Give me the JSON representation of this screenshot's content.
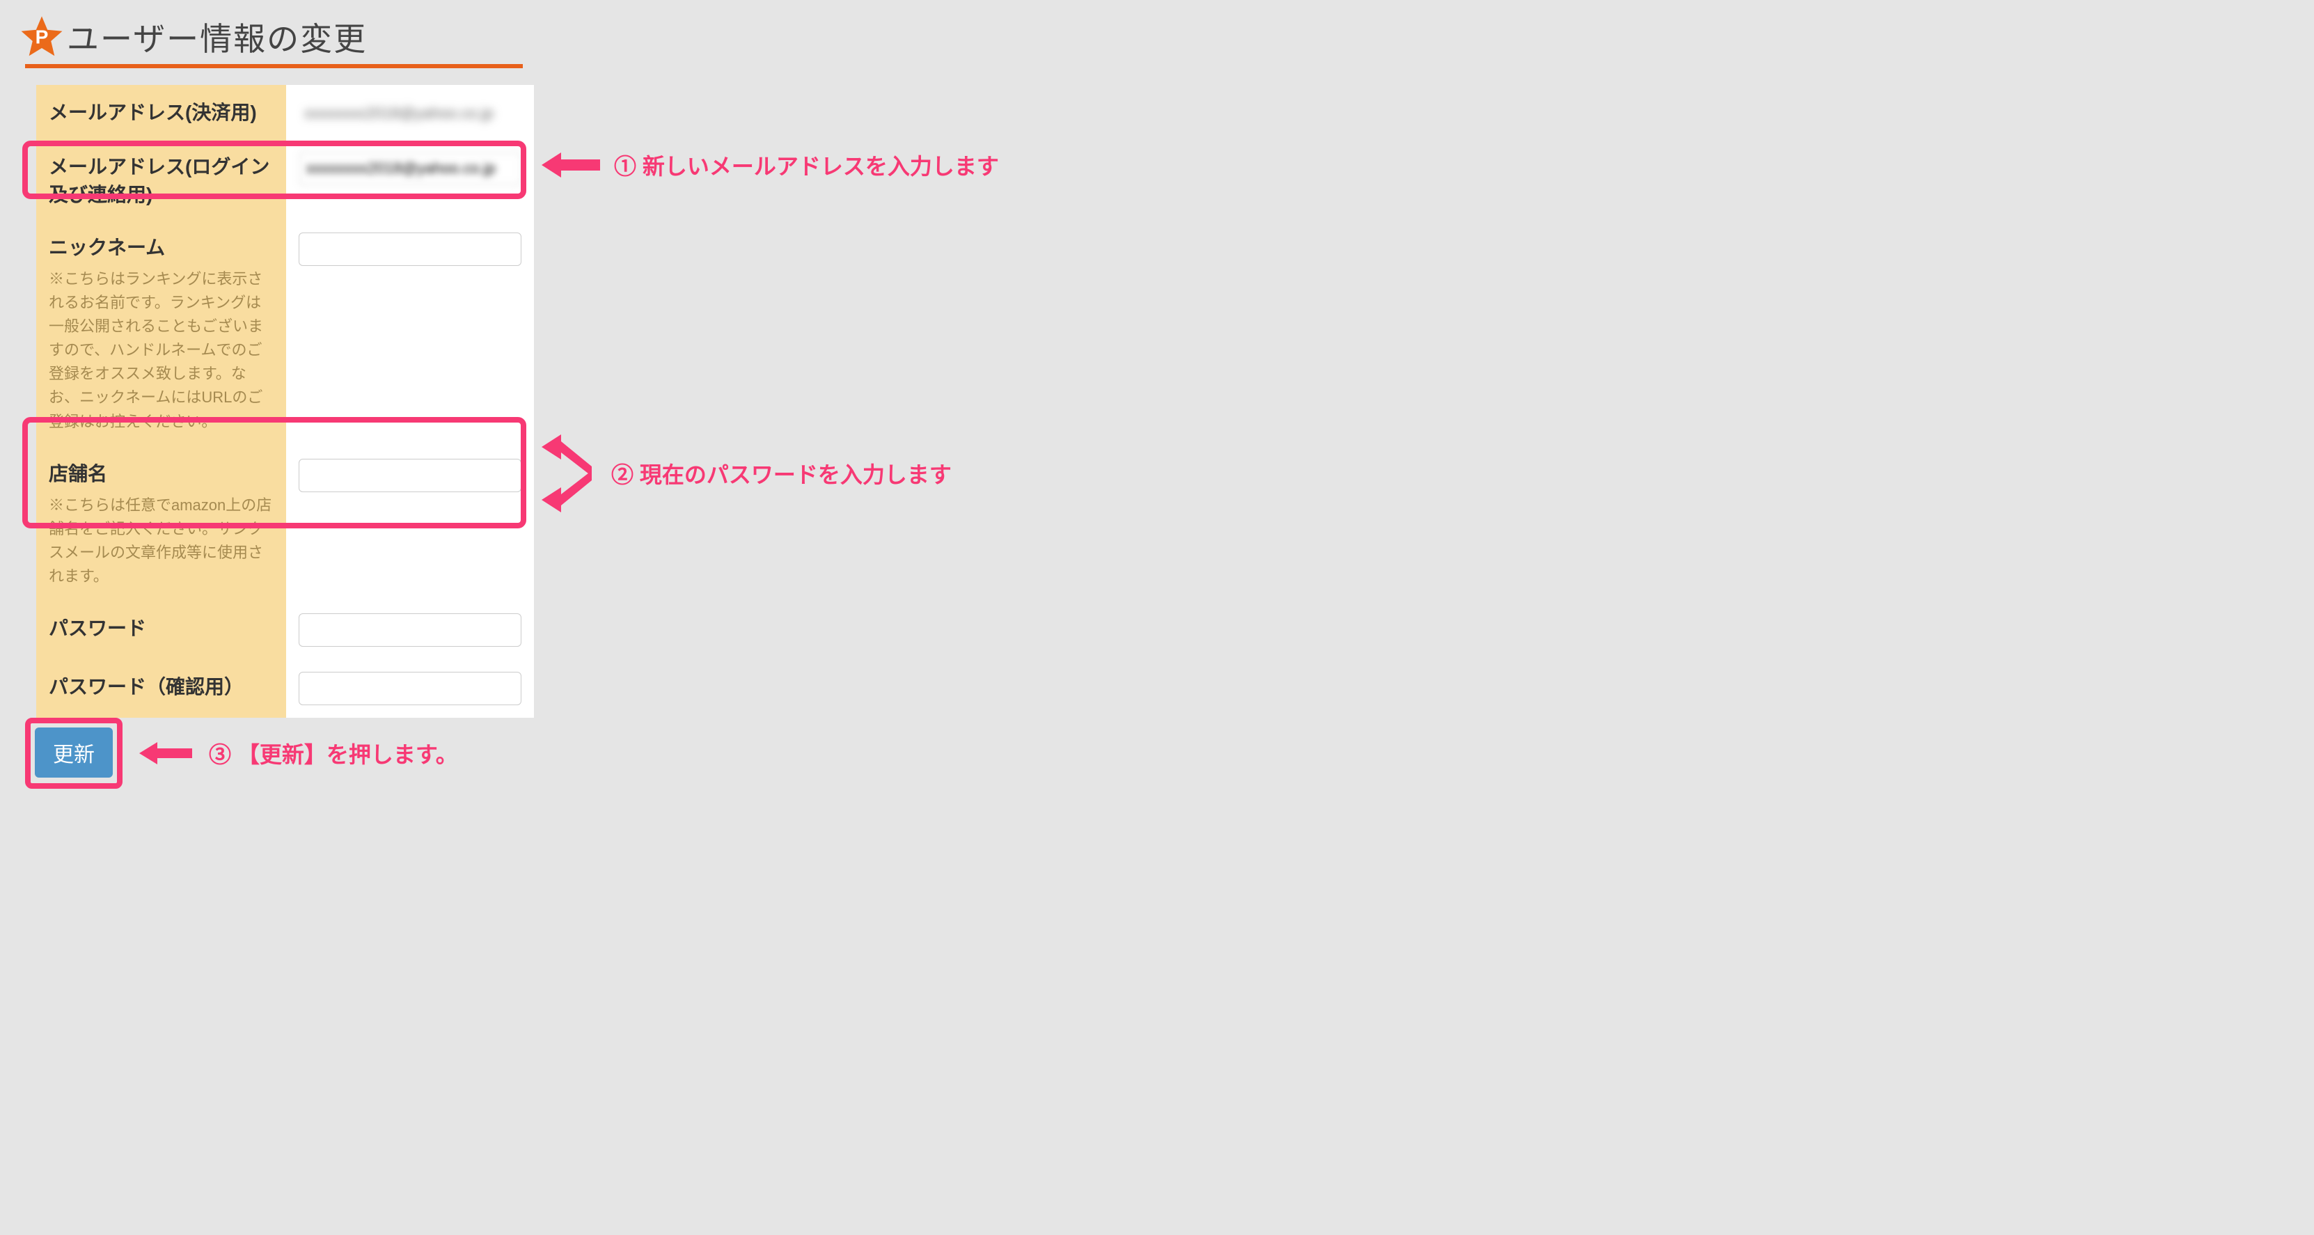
{
  "header": {
    "title": "ユーザー情報の変更",
    "icon": "P"
  },
  "rows": {
    "email_payment": {
      "label": "メールアドレス(決済用)",
      "value_placeholder": "xxxxxxxx2018@yahoo.co.jp"
    },
    "email_login": {
      "label": "メールアドレス(ログイン及び連絡用)",
      "value_placeholder": "xxxxxxxx2018@yahoo.co.jp"
    },
    "nickname": {
      "label": "ニックネーム",
      "note": "※こちらはランキングに表示されるお名前です。ランキングは一般公開されることもございますので、ハンドルネームでのご登録をオススメ致します。なお、ニックネームにはURLのご登録はお控えください。"
    },
    "shop": {
      "label": "店舗名",
      "note": "※こちらは任意でamazon上の店舗名をご記入ください。サンクスメールの文章作成等に使用されます。"
    },
    "password": {
      "label": "パスワード"
    },
    "password_confirm": {
      "label": "パスワード（確認用）"
    }
  },
  "button": {
    "update": "更新"
  },
  "annotations": {
    "a1": "① 新しいメールアドレスを入力します",
    "a2": "② 現在のパスワードを入力します",
    "a3": "③ 【更新】を押します。"
  }
}
